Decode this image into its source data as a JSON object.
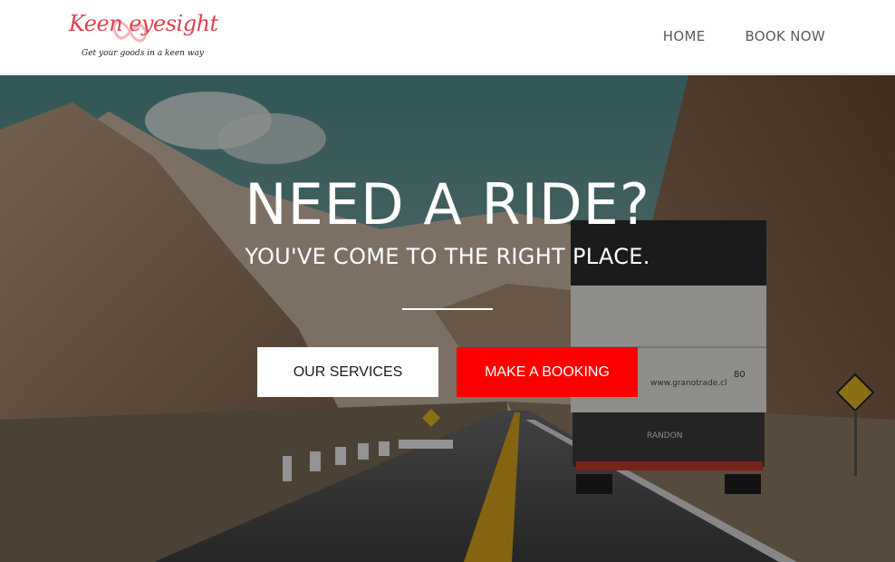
{
  "brand": {
    "name": "Keen eyesight",
    "tagline": "Get your goods in a keen way",
    "color": "#e0414f"
  },
  "nav": {
    "items": [
      {
        "label": "HOME"
      },
      {
        "label": "BOOK NOW"
      }
    ]
  },
  "hero": {
    "title": "NEED A RIDE?",
    "subtitle": "YOU'VE COME TO THE RIGHT PLACE.",
    "primary_button": "OUR SERVICES",
    "secondary_button": "MAKE A BOOKING",
    "accent_color": "#ff0000"
  },
  "truck": {
    "company_text": "www.granotrade.cl",
    "brand_plate": "RANDON",
    "number": "80"
  }
}
